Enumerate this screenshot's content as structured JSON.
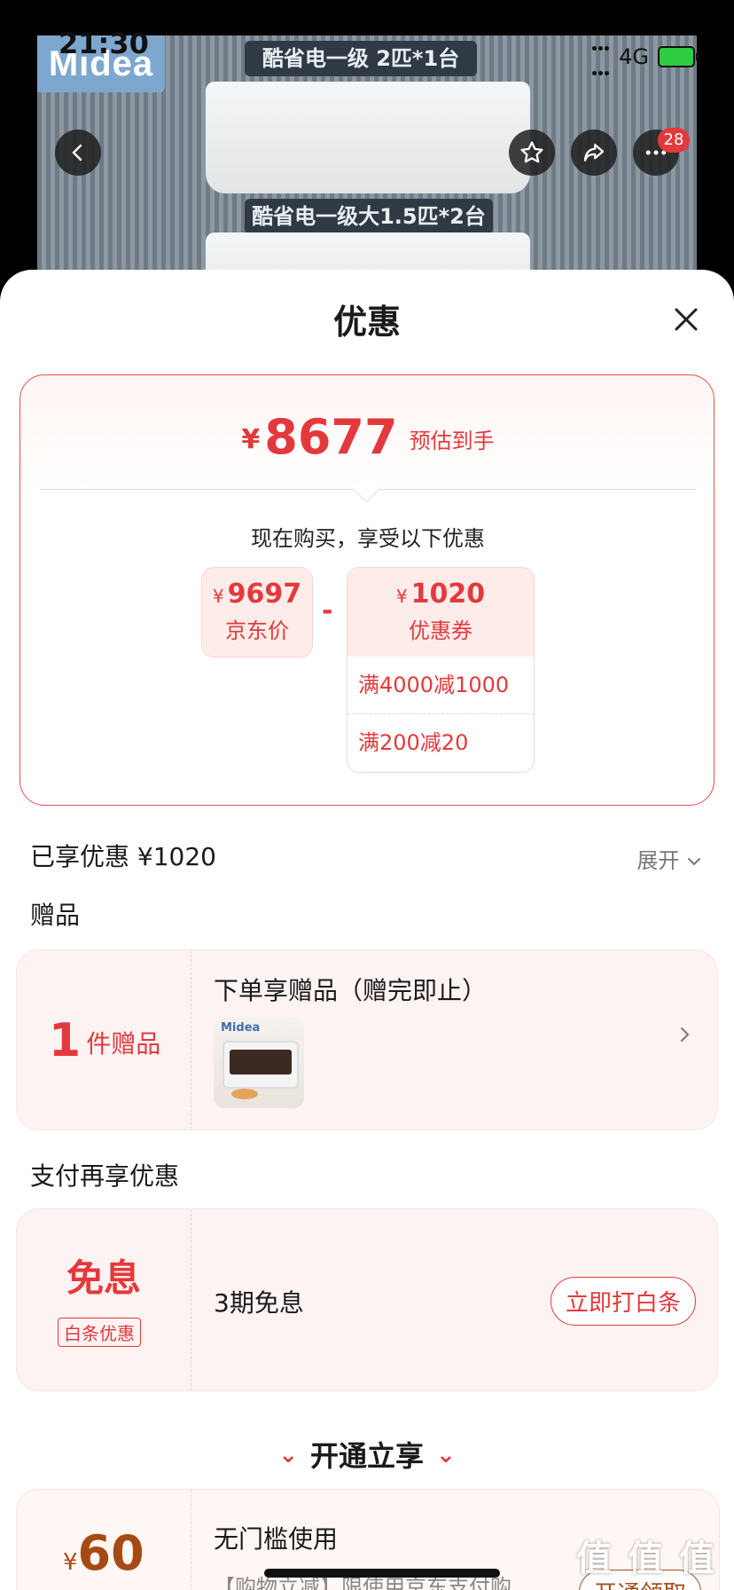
{
  "status_bar": {
    "time": "21:30",
    "network": "4G"
  },
  "banner": {
    "brand": "Midea",
    "spec_1": "酷省电一级 2匹*1台",
    "spec_2": "酷省电一级大1.5匹*2台",
    "cart_count": "28"
  },
  "sheet": {
    "title": "优惠",
    "summary": {
      "currency": "¥",
      "estimated_price": "8677",
      "estimated_label": "预估到手",
      "now_buy_text": "现在购买，享受以下优惠",
      "jd_price": "9697",
      "jd_label": "京东价",
      "minus": "-",
      "coupon_amount": "1020",
      "coupon_label": "优惠券",
      "coupon_rules": [
        "满4000减1000",
        "满200减20"
      ]
    },
    "enjoyed": {
      "text": "已享优惠 ¥1020",
      "expand": "展开"
    },
    "gift": {
      "section_title": "赠品",
      "count": "1",
      "count_unit": "件赠品",
      "title": "下单享赠品（赠完即止）",
      "thumb_brand": "Midea"
    },
    "payment": {
      "section_title": "支付再享优惠",
      "main": "免息",
      "badge": "白条优惠",
      "text": "3期免息",
      "button": "立即打白条"
    },
    "open": {
      "title": "开通立享",
      "currency": "¥",
      "amount": "60",
      "card_title": "无门槛使用",
      "card_desc": "【购物立减】限使用京东支付购...",
      "button": "开通领取"
    }
  },
  "watermark": "值 值 值",
  "colors": {
    "accent": "#e4393c",
    "gold": "#a5501c"
  }
}
